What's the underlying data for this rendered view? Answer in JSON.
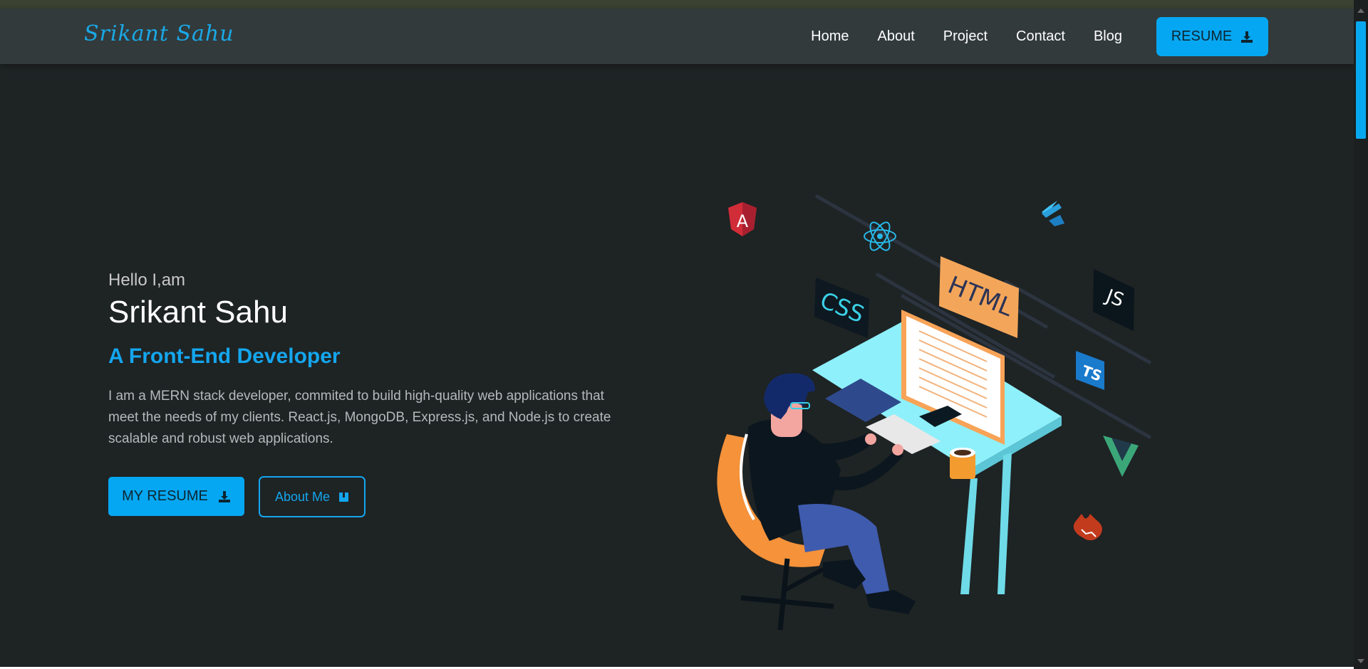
{
  "header": {
    "logo": "Srikant Sahu",
    "nav": [
      "Home",
      "About",
      "Project",
      "Contact",
      "Blog"
    ],
    "resume_label": "RESUME"
  },
  "hero": {
    "greeting": "Hello I,am",
    "name": "Srikant Sahu",
    "role": "A Front-End Developer",
    "description": "I am a MERN stack developer, commited to build high-quality web applications that meet the needs of my clients. React.js, MongoDB, Express.js, and Node.js to create scalable and robust web applications.",
    "primary_button": "MY RESUME",
    "secondary_button": "About Me"
  },
  "illustration": {
    "labels": {
      "html": "HTML",
      "css": "CSS",
      "js": "JS",
      "ts": "TS",
      "angular": "A"
    }
  },
  "colors": {
    "background": "#1e2324",
    "navbar": "#323a3c",
    "accent": "#06a7f2",
    "logo": "#1aa9e6"
  },
  "icons": [
    "download-icon",
    "book-icon",
    "angular-icon",
    "react-icon",
    "flutter-icon",
    "js-icon",
    "ts-icon",
    "vue-icon",
    "html-badge",
    "css-badge"
  ]
}
